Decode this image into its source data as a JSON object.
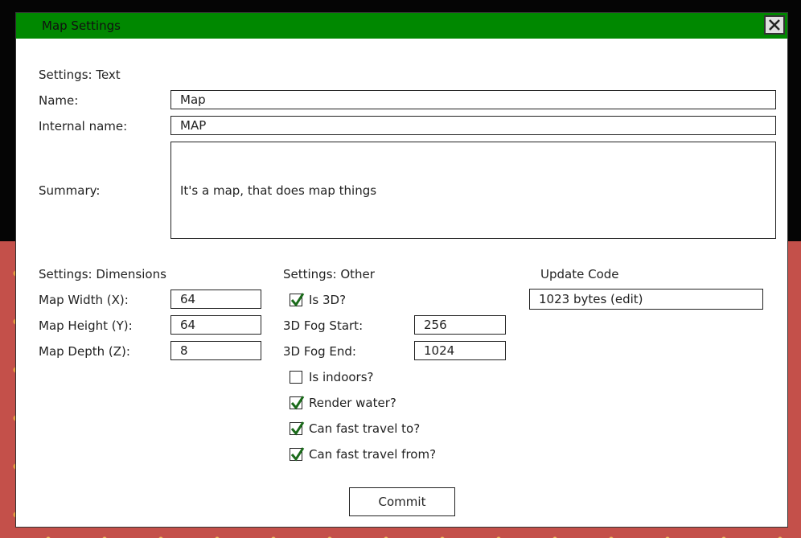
{
  "window": {
    "title": "Map Settings"
  },
  "text_section": {
    "heading": "Settings: Text",
    "name_label": "Name:",
    "name_value": "Map",
    "internal_name_label": "Internal name:",
    "internal_name_value": "MAP",
    "summary_label": "Summary:",
    "summary_value": "It's a map, that does map things"
  },
  "dimensions": {
    "heading": "Settings: Dimensions",
    "width_label": "Map Width (X):",
    "width_value": "64",
    "height_label": "Map Height (Y):",
    "height_value": "64",
    "depth_label": "Map Depth (Z):",
    "depth_value": "8"
  },
  "other": {
    "heading": "Settings: Other",
    "is3d_label": "Is 3D?",
    "is3d_checked": true,
    "fog_start_label": "3D Fog Start:",
    "fog_start_value": "256",
    "fog_end_label": "3D Fog End:",
    "fog_end_value": "1024",
    "indoors_label": "Is indoors?",
    "indoors_checked": false,
    "render_water_label": "Render water?",
    "render_water_checked": true,
    "fast_travel_to_label": "Can fast travel to?",
    "fast_travel_to_checked": true,
    "fast_travel_from_label": "Can fast travel from?",
    "fast_travel_from_checked": true
  },
  "update_code": {
    "heading": "Update Code",
    "value": "1023 bytes (edit)"
  },
  "commit_label": "Commit",
  "colors": {
    "titlebar": "#008800",
    "check": "#1a6a1a"
  }
}
